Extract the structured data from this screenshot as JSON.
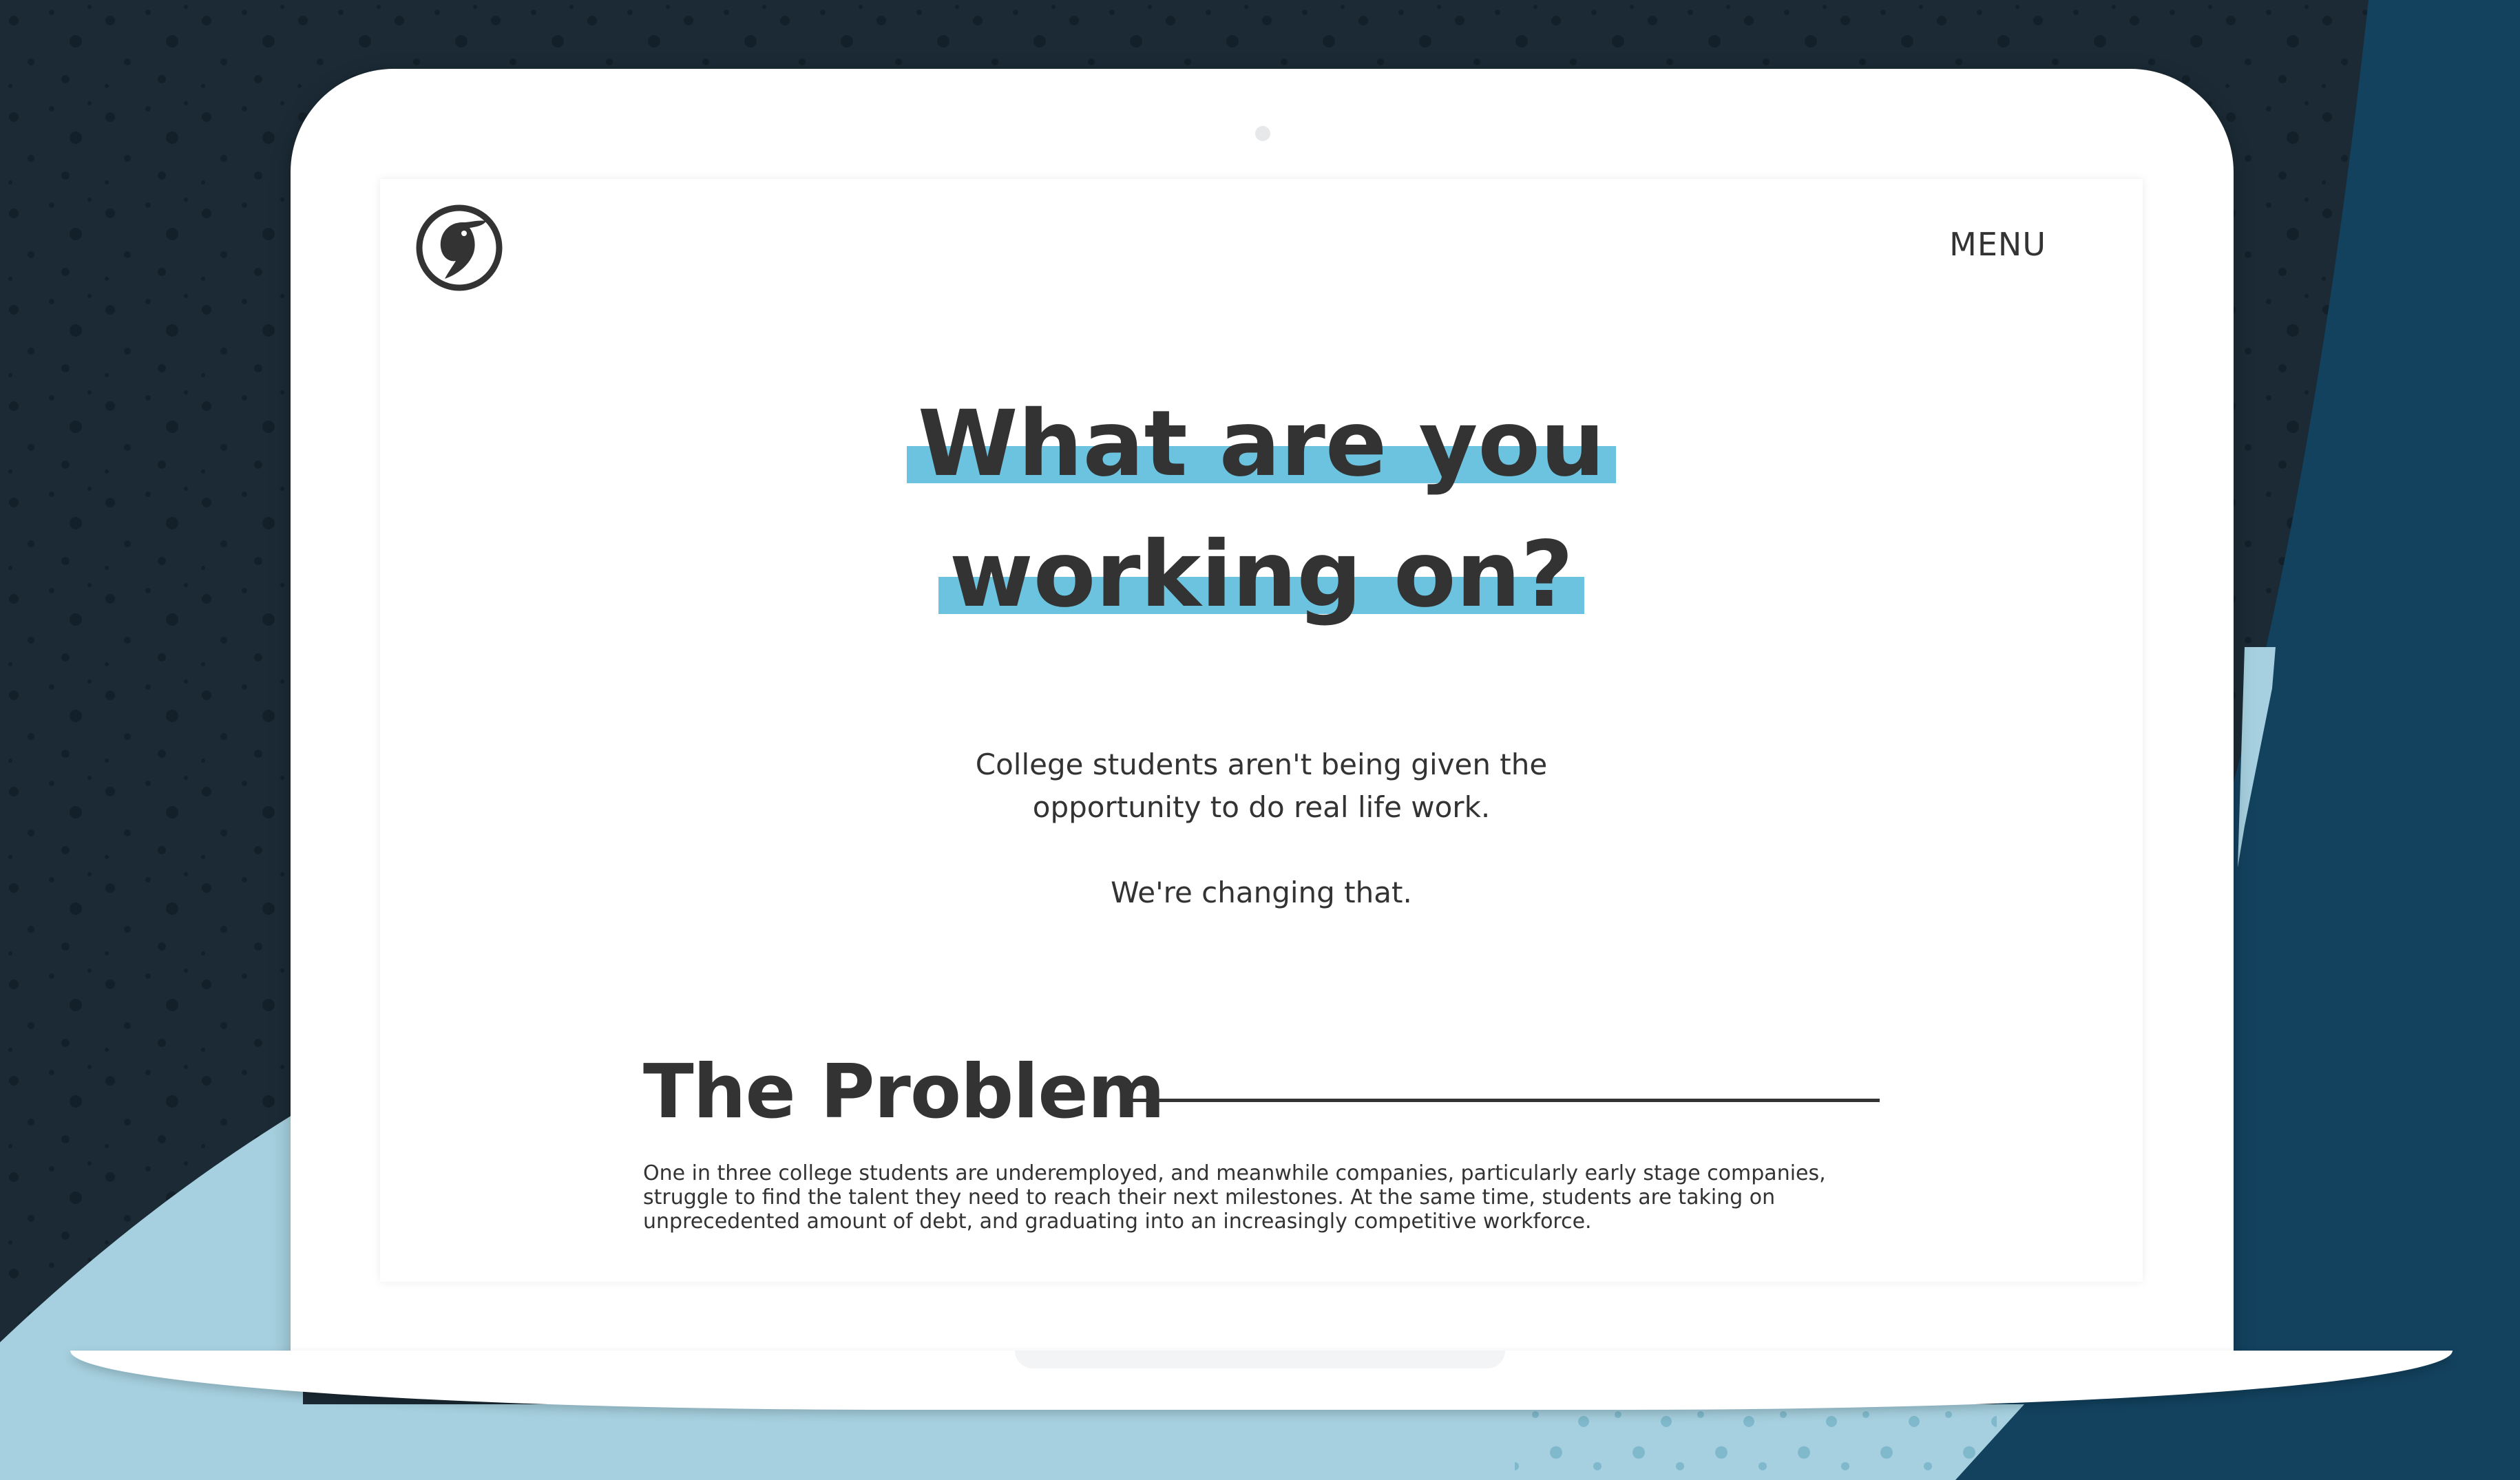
{
  "colors": {
    "page_bg_dark": "#1b2a35",
    "navy_panel": "#13425f",
    "light_blue_shape": "#a6d0df",
    "highlight": "#6cc3df",
    "text_dark": "#333333",
    "laptop_white": "#ffffff"
  },
  "header": {
    "logo_icon": "bird-head-logo-icon",
    "menu_label": "MENU"
  },
  "hero": {
    "line1": "What are you",
    "line2": "working on?"
  },
  "intro": {
    "lead": "College students aren't being given the opportunity to do real life work.",
    "tagline": "We're changing that."
  },
  "problem": {
    "heading": "The Problem",
    "body": "One in three college students are underemployed, and meanwhile companies, particularly early stage companies, struggle to find the talent they need to reach their next milestones. At the same time, students are taking on unprecedented amount of debt, and graduating into an increasingly competitive workforce."
  }
}
